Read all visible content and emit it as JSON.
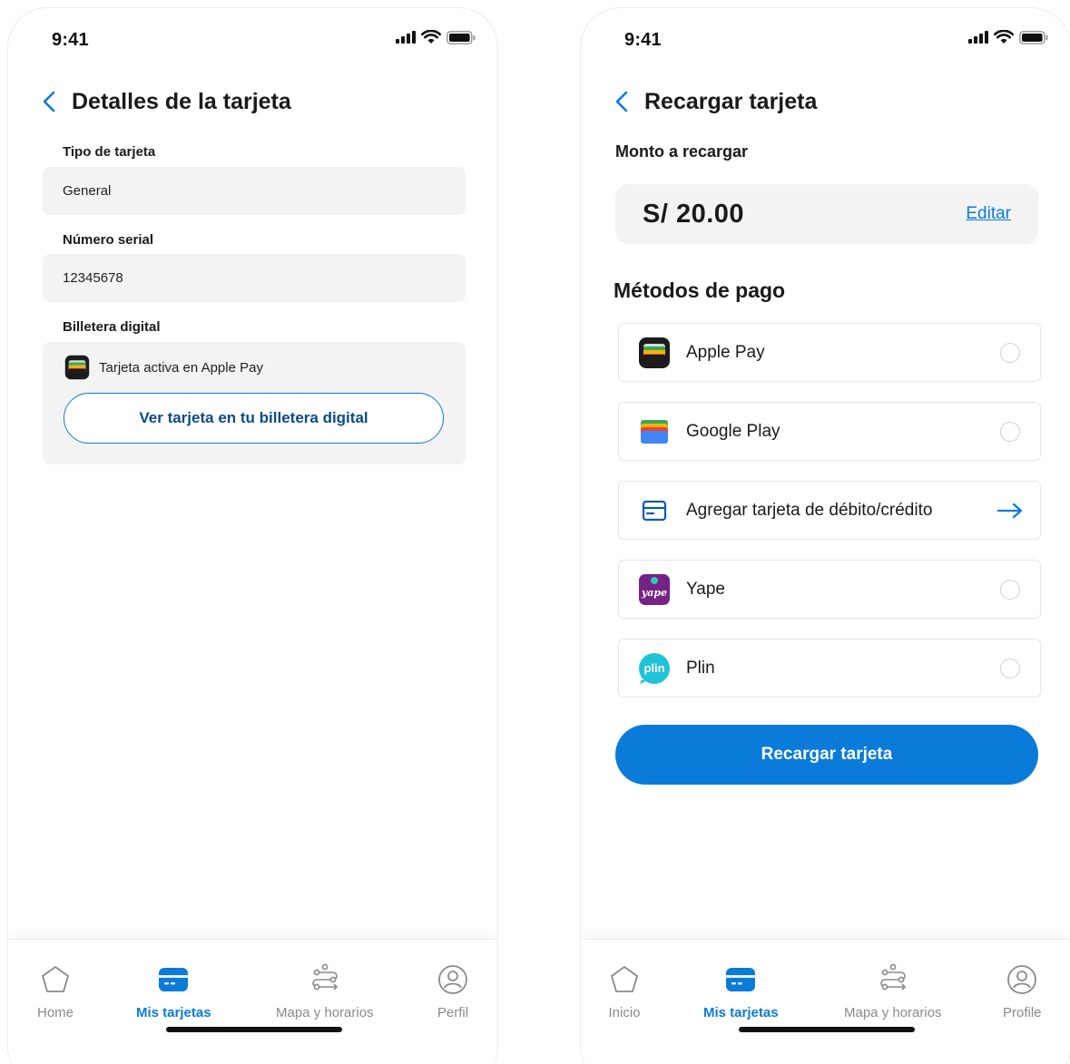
{
  "status_bar": {
    "time": "9:41"
  },
  "left_screen": {
    "title": "Detalles de la tarjeta",
    "fields": [
      {
        "label": "Tipo de tarjeta",
        "value": "General"
      },
      {
        "label": "Número serial",
        "value": "12345678"
      }
    ],
    "wallet": {
      "label": "Billetera digital",
      "status_text": "Tarjeta activa en Apple Pay",
      "button_label": "Ver tarjeta en tu billetera digital"
    },
    "tabs": [
      {
        "label": "Home",
        "icon": "home-icon"
      },
      {
        "label": "Mis tarjetas",
        "icon": "card-icon"
      },
      {
        "label": "Mapa y horarios",
        "icon": "route-icon"
      },
      {
        "label": "Perfil",
        "icon": "profile-icon"
      }
    ],
    "active_tab": "Mis tarjetas"
  },
  "right_screen": {
    "title": "Recargar tarjeta",
    "amount_label": "Monto a recargar",
    "amount_value": "S/ 20.00",
    "edit_label": "Editar",
    "methods_title": "Métodos de pago",
    "methods": [
      {
        "label": "Apple Pay",
        "icon": "apple-wallet-icon",
        "control": "radio"
      },
      {
        "label": "Google Play",
        "icon": "google-wallet-icon",
        "control": "radio"
      },
      {
        "label": "Agregar tarjeta de débito/crédito",
        "icon": "credit-card-icon",
        "control": "arrow"
      },
      {
        "label": "Yape",
        "icon": "yape-icon",
        "control": "radio"
      },
      {
        "label": "Plin",
        "icon": "plin-icon",
        "control": "radio"
      }
    ],
    "yape_logo_text": "yape",
    "plin_logo_text": "plin",
    "submit_label": "Recargar tarjeta",
    "tabs": [
      {
        "label": "Inicio",
        "icon": "home-icon"
      },
      {
        "label": "Mis tarjetas",
        "icon": "card-icon"
      },
      {
        "label": "Mapa y horarios",
        "icon": "route-icon"
      },
      {
        "label": "Profile",
        "icon": "profile-icon"
      }
    ],
    "active_tab": "Mis tarjetas"
  },
  "colors": {
    "accent": "#0a7bd8",
    "field_background": "#f3f3f3",
    "wallet_button_text": "#0c4a86"
  }
}
